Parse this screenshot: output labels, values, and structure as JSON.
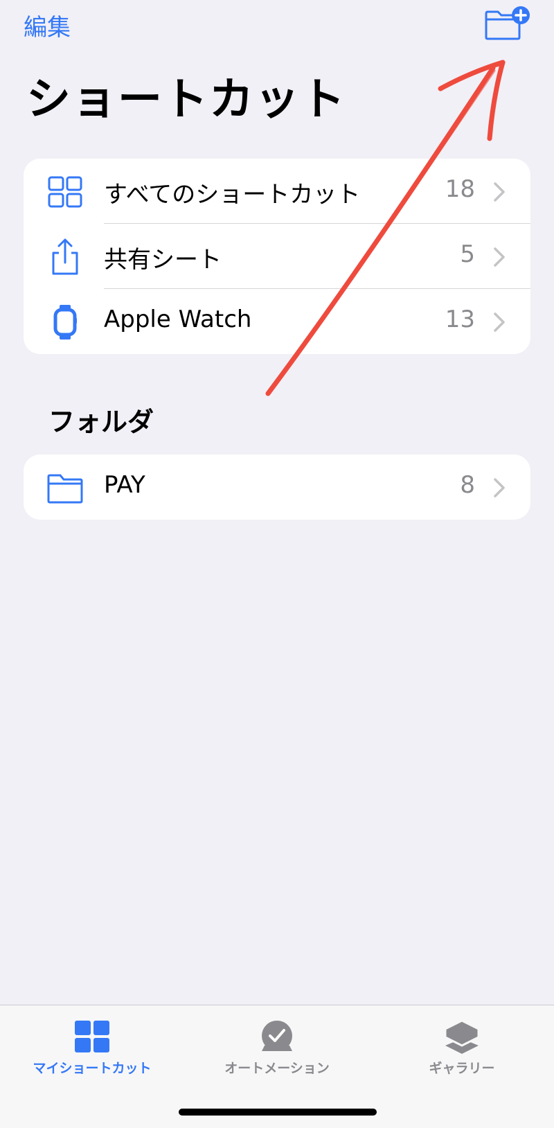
{
  "header": {
    "edit_label": "編集",
    "new_folder_icon": "folder-plus-icon",
    "title": "ショートカット"
  },
  "library": {
    "items": [
      {
        "label": "すべてのショートカット",
        "count": "18",
        "icon": "grid-icon"
      },
      {
        "label": "共有シート",
        "count": "5",
        "icon": "share-icon"
      },
      {
        "label": "Apple Watch",
        "count": "13",
        "icon": "watch-icon"
      }
    ]
  },
  "folders": {
    "heading": "フォルダ",
    "items": [
      {
        "label": "PAY",
        "count": "8",
        "icon": "folder-icon"
      }
    ]
  },
  "tabbar": {
    "tabs": [
      {
        "label": "マイショートカット",
        "icon": "grid-icon",
        "active": true
      },
      {
        "label": "オートメーション",
        "icon": "checkmark-clock-icon",
        "active": false
      },
      {
        "label": "ギャラリー",
        "icon": "stack-icon",
        "active": false
      }
    ]
  },
  "colors": {
    "accent": "#3478f6",
    "background": "#f1f0f6",
    "annotation": "#ee4b3e",
    "inactive": "#8a8a8e"
  }
}
